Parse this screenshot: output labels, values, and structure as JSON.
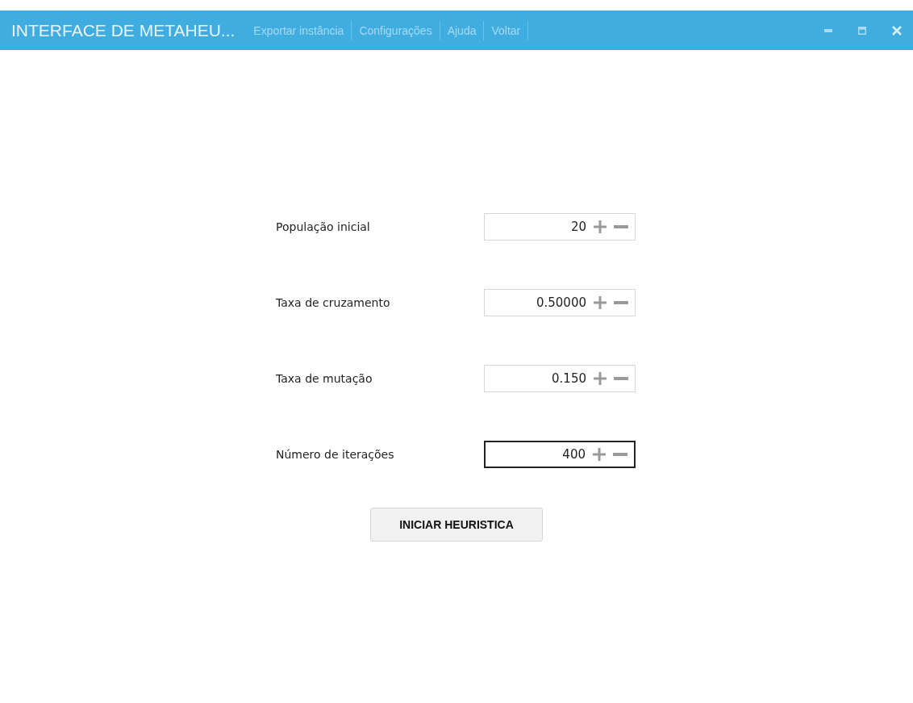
{
  "window": {
    "title": "INTERFACE DE METAHEU..."
  },
  "menu": [
    {
      "label": "Exportar instância"
    },
    {
      "label": "Configurações"
    },
    {
      "label": "Ajuda"
    },
    {
      "label": "Voltar"
    }
  ],
  "fields": [
    {
      "label": "População inicial",
      "value": "20",
      "focused": false
    },
    {
      "label": "Taxa de cruzamento",
      "value": "0.50000",
      "focused": false
    },
    {
      "label": "Taxa de mutação",
      "value": "0.150",
      "focused": false
    },
    {
      "label": "Número de iterações",
      "value": "400",
      "focused": true
    }
  ],
  "start_button": {
    "label": "INICIAR HEURISTICA"
  }
}
